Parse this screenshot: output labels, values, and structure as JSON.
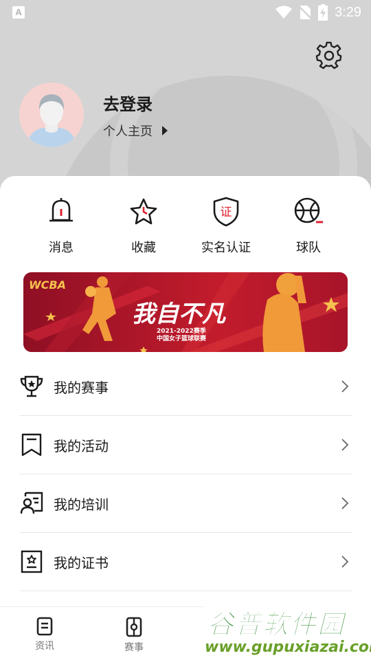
{
  "status_bar": {
    "time": "3:29",
    "notification_icon_letter": "A"
  },
  "profile": {
    "login_label": "去登录",
    "homepage_label": "个人主页"
  },
  "quick_actions": [
    {
      "label": "消息",
      "icon": "bell-icon"
    },
    {
      "label": "收藏",
      "icon": "star-icon"
    },
    {
      "label": "实名认证",
      "icon": "verify-shield-icon",
      "icon_text": "证"
    },
    {
      "label": "球队",
      "icon": "basketball-icon"
    }
  ],
  "banner": {
    "logo_text": "WCBA",
    "headline": "我自不凡",
    "season": "2021-2022赛季",
    "league": "中国女子篮球联赛"
  },
  "menu": [
    {
      "label": "我的赛事",
      "icon": "trophy-icon"
    },
    {
      "label": "我的活动",
      "icon": "bookmark-icon"
    },
    {
      "label": "我的培训",
      "icon": "training-icon"
    },
    {
      "label": "我的证书",
      "icon": "certificate-icon"
    }
  ],
  "tabbar": [
    {
      "label": "资讯",
      "icon": "news-icon"
    },
    {
      "label": "赛事",
      "icon": "match-icon"
    }
  ],
  "watermark": {
    "title": "谷普软件园",
    "url": "www.gupuxiazai.com"
  },
  "colors": {
    "accent": "#e0202e",
    "header_bg": "#d4d4d4",
    "banner_bg": "#a8142a"
  }
}
